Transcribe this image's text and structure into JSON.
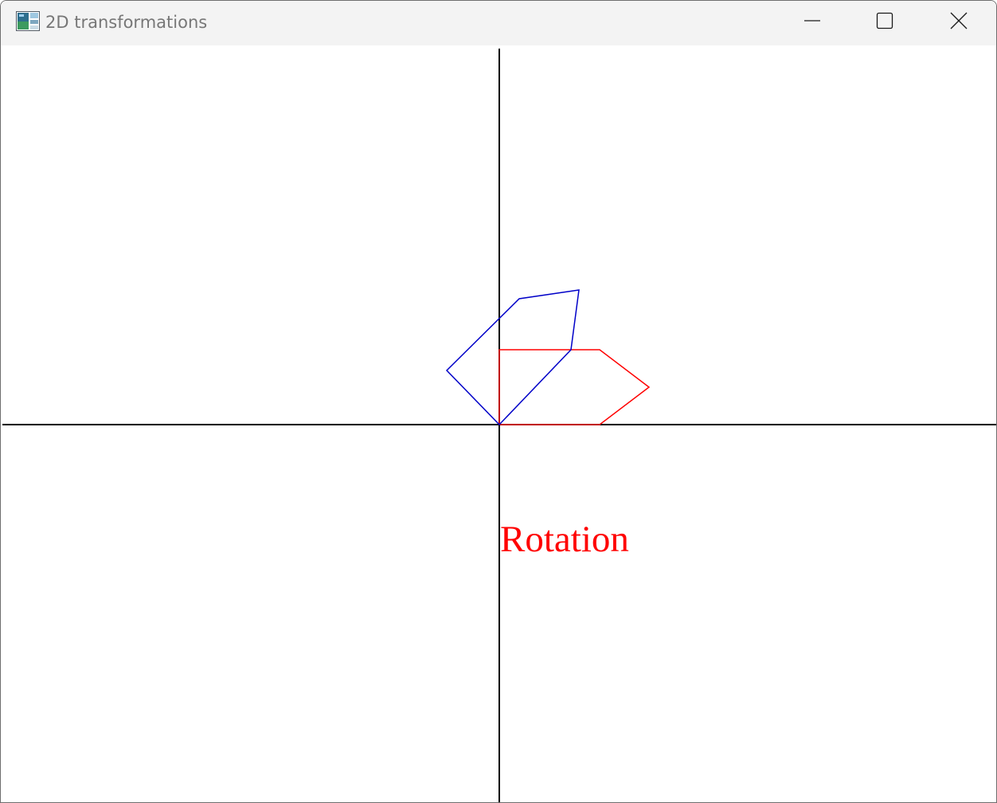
{
  "window": {
    "title": "2D transformations",
    "icons": {
      "app": "application-icon",
      "minimize": "minimize-icon",
      "maximize": "maximize-icon",
      "close": "close-icon"
    }
  },
  "canvas": {
    "background": "#ffffff",
    "axis_color": "#000000",
    "caption": "Rotation",
    "caption_color": "#ff0000",
    "shapes": {
      "original_color": "#ff0000",
      "rotated_color": "#0000c8"
    }
  }
}
